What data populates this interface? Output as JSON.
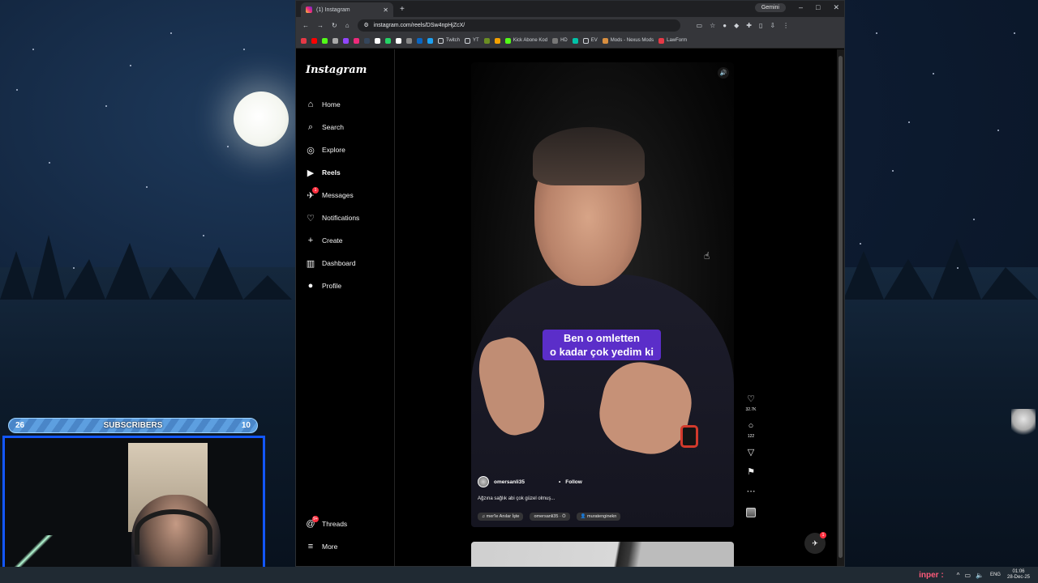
{
  "browser": {
    "tab_title": "(1) Instagram",
    "new_tab": "+",
    "gemini_label": "Gemini",
    "url": "instagram.com/reels/DSw4npHjZcX/",
    "window_buttons": [
      "–",
      "□",
      "✕"
    ],
    "bookmarks": [
      {
        "label": "",
        "color": "#e63946"
      },
      {
        "label": "",
        "color": "#ff0000"
      },
      {
        "label": "",
        "color": "#53fc18"
      },
      {
        "label": "",
        "color": "#aaaaaa"
      },
      {
        "label": "",
        "color": "#9146ff"
      },
      {
        "label": "",
        "color": "#ee2a7b"
      },
      {
        "label": "",
        "color": "#35465c"
      },
      {
        "label": "",
        "color": "#ffffff"
      },
      {
        "label": "",
        "color": "#25d366"
      },
      {
        "label": "",
        "color": "#ffffff"
      },
      {
        "label": "",
        "color": "#888888"
      },
      {
        "label": "",
        "color": "#0a66c2"
      },
      {
        "label": "",
        "color": "#1da1f2"
      },
      {
        "label": "Twitch",
        "color": ""
      },
      {
        "label": "YT",
        "color": ""
      },
      {
        "label": "",
        "color": "#6b8e23"
      },
      {
        "label": "",
        "color": "#f4a100"
      },
      {
        "label": "Kick Abone Kod",
        "color": "#53fc18"
      },
      {
        "label": "HD",
        "color": "#777777"
      },
      {
        "label": "",
        "color": "#00c2a8"
      },
      {
        "label": "EV",
        "color": ""
      },
      {
        "label": "Mods - Nexus Mods",
        "color": "#d98f40"
      },
      {
        "label": "LawForm",
        "color": "#e63946"
      }
    ]
  },
  "instagram": {
    "logo": "Instagram",
    "nav": [
      {
        "label": "Home",
        "icon": "home-icon",
        "glyph": "⌂"
      },
      {
        "label": "Search",
        "icon": "search-icon",
        "glyph": "⌕"
      },
      {
        "label": "Explore",
        "icon": "compass-icon",
        "glyph": "◎"
      },
      {
        "label": "Reels",
        "icon": "reels-icon",
        "glyph": "▶"
      },
      {
        "label": "Messages",
        "icon": "messenger-icon",
        "glyph": "✈"
      },
      {
        "label": "Notifications",
        "icon": "heart-icon",
        "glyph": "♡"
      },
      {
        "label": "Create",
        "icon": "plus-icon",
        "glyph": "+"
      },
      {
        "label": "Dashboard",
        "icon": "dashboard-icon",
        "glyph": "▥"
      },
      {
        "label": "Profile",
        "icon": "profile-avatar-icon",
        "glyph": "●"
      }
    ],
    "bottom_nav": [
      {
        "label": "Threads",
        "icon": "threads-icon",
        "glyph": "@",
        "badge": "9+"
      },
      {
        "label": "More",
        "icon": "menu-icon",
        "glyph": "≡"
      }
    ],
    "messages_badge": "1",
    "reel": {
      "subtitle_line1": "Ben o omletten",
      "subtitle_line2": "o kadar çok yedim ki",
      "author": "omersanli35",
      "follow_separator": "•",
      "follow": "Follow",
      "caption": "Ağzına sağlık abi çok güzel olmuş...",
      "audio": "mer'le Anılar İşte",
      "audio_source": "omersanli35 · Ö",
      "tagged_user": "muratenginekn",
      "likes": "32.7K",
      "comments": "122"
    },
    "fab_badge": "1"
  },
  "stream_overlay": {
    "sub_left": "26",
    "sub_title": "SUBSCRIBERS",
    "sub_right": "10"
  },
  "taskbar": {
    "user_label": "inper :",
    "lang": "ENG",
    "time": "01:06",
    "date": "28-Dec-25"
  }
}
